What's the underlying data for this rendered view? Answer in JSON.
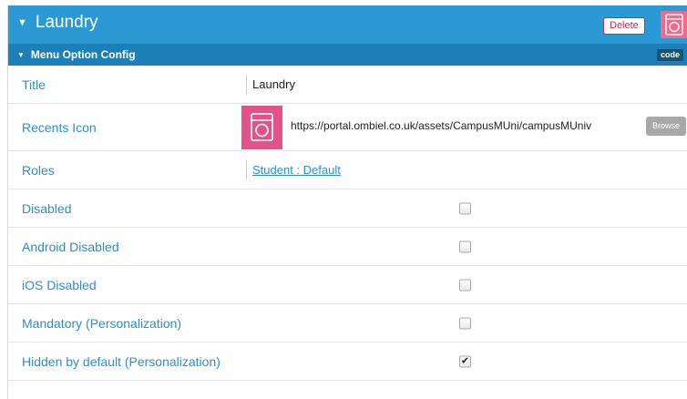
{
  "header": {
    "title": "Laundry",
    "delete_label": "Delete",
    "icon": "washing-machine-icon",
    "accent": "#2b9ad4"
  },
  "subheader": {
    "title": "Menu Option Config",
    "code_label": "code",
    "color": "#1c7fb6"
  },
  "fields": {
    "title": {
      "label": "Title",
      "value": "Laundry"
    },
    "recents_icon": {
      "label": "Recents Icon",
      "icon": "washing-machine-icon",
      "url": "https://portal.ombiel.co.uk/assets/CampusMUni/campusMUniv",
      "browse_label": "Browse"
    },
    "roles": {
      "label": "Roles",
      "value": "Student : Default"
    },
    "disabled": {
      "label": "Disabled",
      "checked": false
    },
    "android_disabled": {
      "label": "Android Disabled",
      "checked": false
    },
    "ios_disabled": {
      "label": "iOS Disabled",
      "checked": false
    },
    "mandatory": {
      "label": "Mandatory (Personalization)",
      "checked": false
    },
    "hidden_default": {
      "label": "Hidden by default (Personalization)",
      "checked": true,
      "mark": "✔"
    }
  }
}
